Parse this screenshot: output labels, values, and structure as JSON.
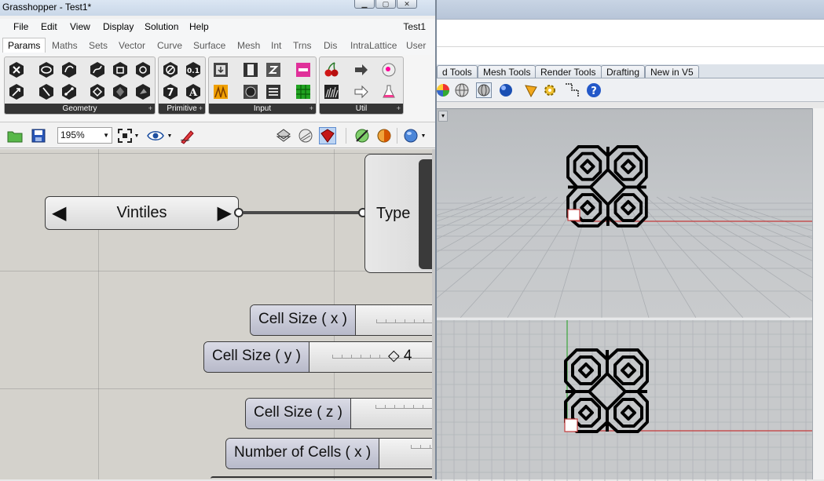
{
  "gh_window": {
    "title": "Grasshopper - Test1*",
    "doc_name": "Test1",
    "window_controls": [
      "minimize",
      "maximize",
      "close"
    ]
  },
  "menu": [
    "File",
    "Edit",
    "View",
    "Display",
    "Solution",
    "Help"
  ],
  "tabs": [
    {
      "label": "Params",
      "active": true
    },
    {
      "label": "Maths"
    },
    {
      "label": "Sets"
    },
    {
      "label": "Vector"
    },
    {
      "label": "Curve"
    },
    {
      "label": "Surface"
    },
    {
      "label": "Mesh"
    },
    {
      "label": "Int"
    },
    {
      "label": "Trns"
    },
    {
      "label": "Dis"
    },
    {
      "label": "IntraLattice"
    },
    {
      "label": "User"
    }
  ],
  "ribbon_groups": [
    {
      "label": "Geometry",
      "icons": [
        "point-icon",
        "circle-icon",
        "arc-icon",
        "curve-icon",
        "box-icon",
        "brep-icon",
        "vector-icon",
        "line-icon",
        "plane-icon",
        "surface-icon",
        "mesh-icon",
        "geometry-icon"
      ]
    },
    {
      "label": "Primitive",
      "icons": [
        "boolean-icon",
        "number-icon",
        "integer-icon",
        "text-icon"
      ]
    },
    {
      "label": "Input",
      "icons": [
        "panel-icon",
        "slider-icon",
        "toggle-icon",
        "graph-icon",
        "gradient-icon",
        "list-icon",
        "swatch-icon",
        "button-icon"
      ]
    },
    {
      "label": "Util",
      "icons": [
        "cherry-icon",
        "relay-icon",
        "data-dam-icon",
        "jump-icon",
        "cluster-icon",
        "flask-icon"
      ]
    }
  ],
  "ribbon_text": {
    "number_glyph": "0.1",
    "integer_glyph": "7",
    "text_glyph": "A"
  },
  "toolbar": {
    "zoom": "195%"
  },
  "canvas": {
    "value_list": {
      "label": "Vintiles",
      "left_arrow": "◀",
      "right_arrow": "▶"
    },
    "type_component": {
      "label": "Type"
    },
    "sliders": [
      {
        "label": "Cell Size ( x )",
        "value": ""
      },
      {
        "label": "Cell Size ( y )",
        "value": "◇ 4"
      },
      {
        "label": "Cell Size ( z )",
        "value": ""
      },
      {
        "label": "Number of Cells ( x )",
        "value": ""
      }
    ]
  },
  "rhino": {
    "toolbar_tabs": [
      "d Tools",
      "Mesh Tools",
      "Render Tools",
      "Drafting",
      "New in V5"
    ],
    "toolbar_icons": [
      "color-wheel-icon",
      "shaded-sphere-icon",
      "rendered-sphere-icon",
      "blue-sphere-icon",
      "light-icon",
      "gear-icon",
      "grid-snap-icon",
      "help-icon"
    ],
    "axis_colors": {
      "x": "#c43a3a",
      "y": "#3aa53a"
    },
    "pattern_color": "#000000"
  }
}
